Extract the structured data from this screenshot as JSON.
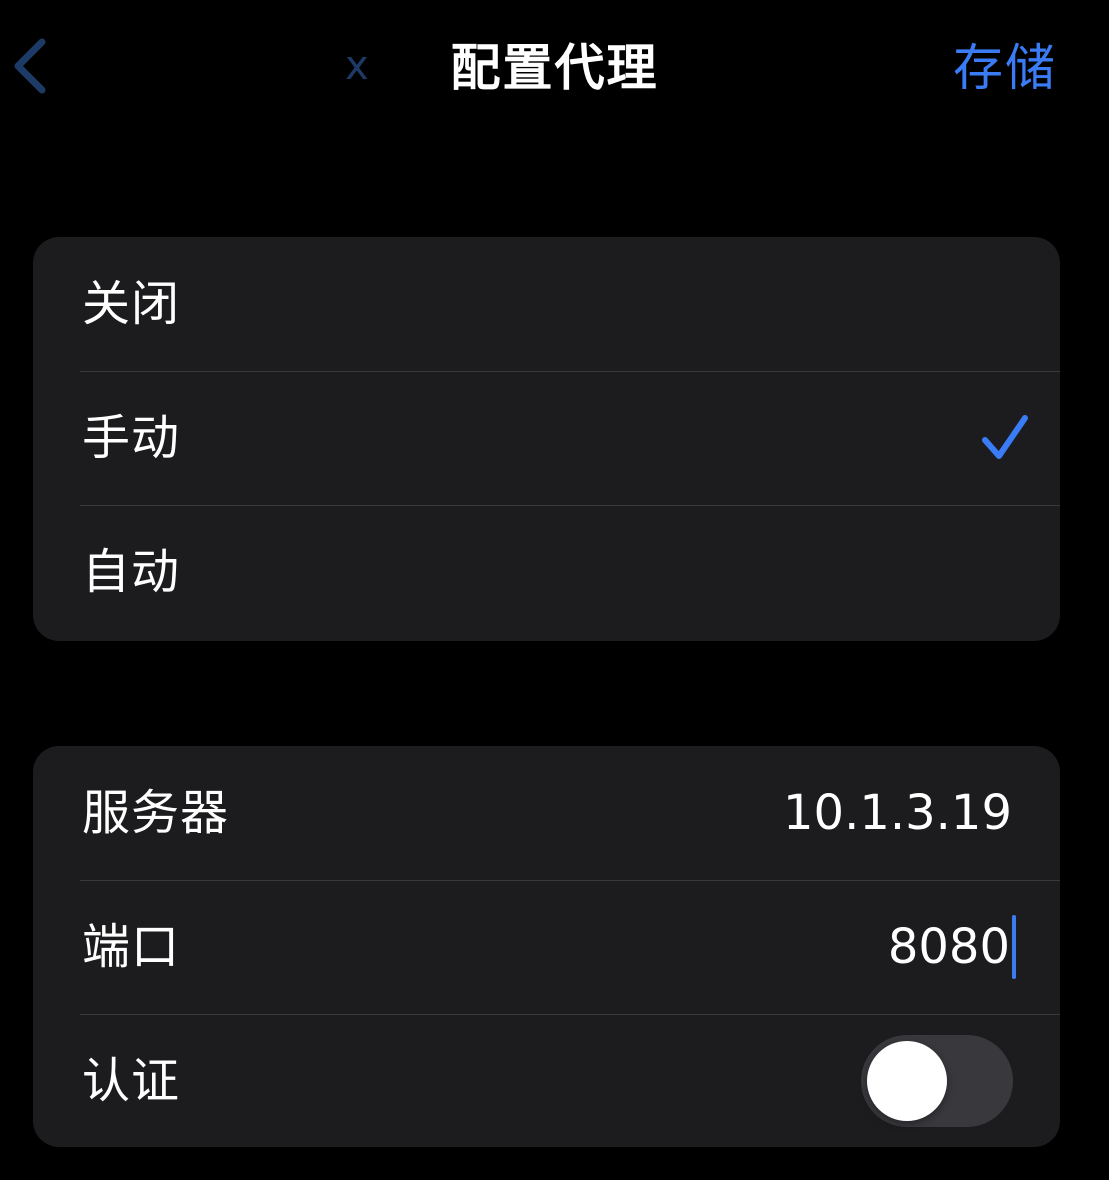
{
  "nav": {
    "back_hint": "x",
    "title": "配置代理",
    "save_label": "存储"
  },
  "proxy_mode": {
    "options": [
      {
        "label": "关闭",
        "selected": false
      },
      {
        "label": "手动",
        "selected": true
      },
      {
        "label": "自动",
        "selected": false
      }
    ]
  },
  "manual": {
    "server_label": "服务器",
    "server_value": "10.1.3.19",
    "port_label": "端口",
    "port_value": "8080",
    "auth_label": "认证",
    "auth_enabled": false
  },
  "colors": {
    "accent": "#3a7cf5",
    "toggle_off": "#39393d",
    "background": "#000000",
    "group_background": "#1c1c1e"
  },
  "icons": {
    "back": "chevron-left-icon",
    "selected": "checkmark-icon"
  }
}
